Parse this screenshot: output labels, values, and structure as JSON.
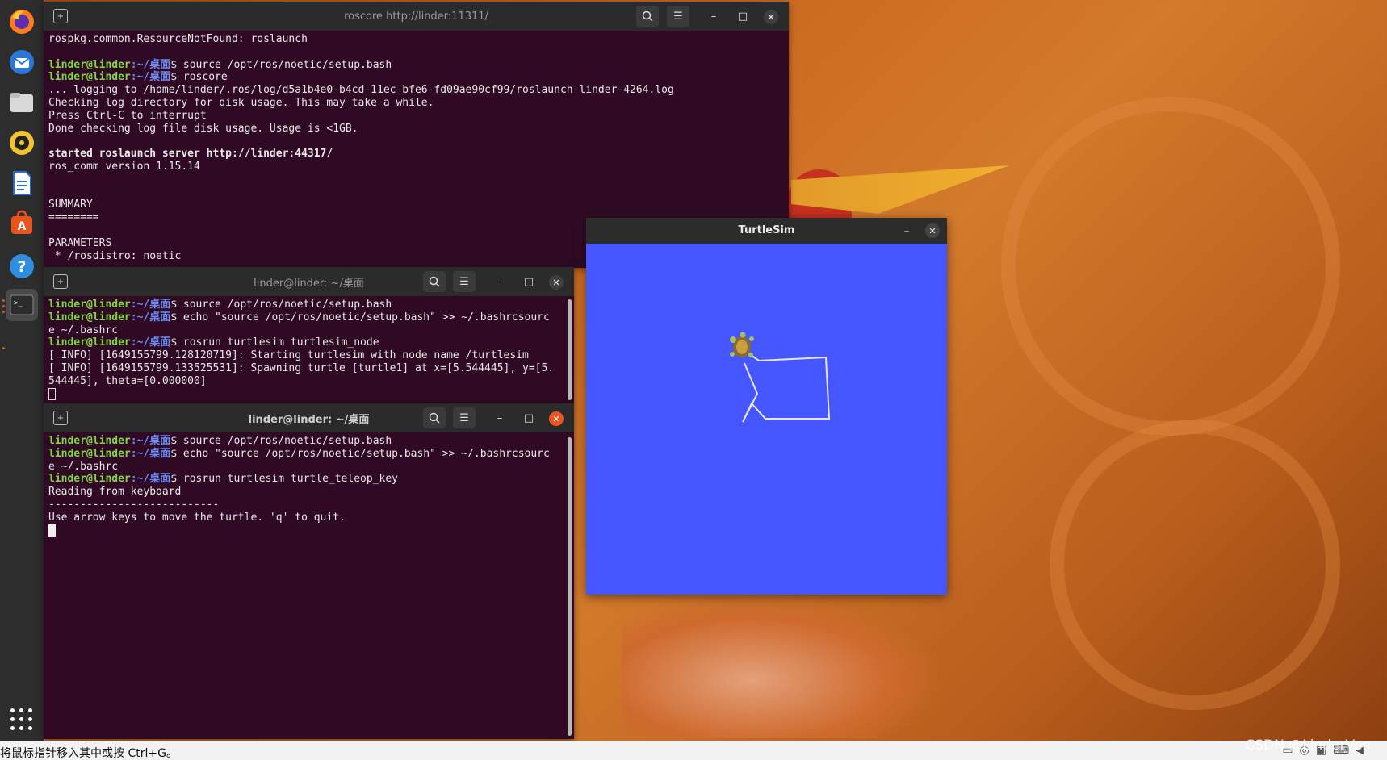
{
  "desktop": {
    "watermark": "CSDN @LinderVen"
  },
  "dock": {
    "items": [
      {
        "name": "firefox-icon"
      },
      {
        "name": "thunderbird-icon"
      },
      {
        "name": "files-icon"
      },
      {
        "name": "rhythmbox-icon"
      },
      {
        "name": "writer-icon"
      },
      {
        "name": "software-icon"
      },
      {
        "name": "help-icon"
      },
      {
        "name": "terminal-icon"
      }
    ]
  },
  "terminal1": {
    "title": "roscore http://linder:11311/",
    "lines": [
      {
        "text": "rospkg.common.ResourceNotFound: roslaunch"
      },
      {
        "text": ""
      },
      {
        "user": "linder@linder",
        "path": ":~/桌面",
        "text": "$ source /opt/ros/noetic/setup.bash"
      },
      {
        "user": "linder@linder",
        "path": ":~/桌面",
        "text": "$ roscore"
      },
      {
        "text": "... logging to /home/linder/.ros/log/d5a1b4e0-b4cd-11ec-bfe6-fd09ae90cf99/roslaunch-linder-4264.log"
      },
      {
        "text": "Checking log directory for disk usage. This may take a while."
      },
      {
        "text": "Press Ctrl-C to interrupt"
      },
      {
        "text": "Done checking log file disk usage. Usage is <1GB."
      },
      {
        "text": ""
      },
      {
        "text": "started roslaunch server http://linder:44317/",
        "bold": true
      },
      {
        "text": "ros_comm version 1.15.14"
      },
      {
        "text": ""
      },
      {
        "text": ""
      },
      {
        "text": "SUMMARY"
      },
      {
        "text": "========"
      },
      {
        "text": ""
      },
      {
        "text": "PARAMETERS"
      },
      {
        "text": " * /rosdistro: noetic"
      }
    ]
  },
  "terminal2": {
    "title": "linder@linder: ~/桌面",
    "lines": [
      {
        "user": "linder@linder",
        "path": ":~/桌面",
        "text": "$ source /opt/ros/noetic/setup.bash"
      },
      {
        "user": "linder@linder",
        "path": ":~/桌面",
        "text": "$ echo \"source /opt/ros/noetic/setup.bash\" >> ~/.bashrcsourc"
      },
      {
        "text": "e ~/.bashrc"
      },
      {
        "user": "linder@linder",
        "path": ":~/桌面",
        "text": "$ rosrun turtlesim turtlesim_node"
      },
      {
        "text": "[ INFO] [1649155799.128120719]: Starting turtlesim with node name /turtlesim"
      },
      {
        "text": "[ INFO] [1649155799.133525531]: Spawning turtle [turtle1] at x=[5.544445], y=[5."
      },
      {
        "text": "544445], theta=[0.000000]"
      }
    ]
  },
  "terminal3": {
    "title": "linder@linder: ~/桌面",
    "lines": [
      {
        "user": "linder@linder",
        "path": ":~/桌面",
        "text": "$ source /opt/ros/noetic/setup.bash"
      },
      {
        "user": "linder@linder",
        "path": ":~/桌面",
        "text": "$ echo \"source /opt/ros/noetic/setup.bash\" >> ~/.bashrcsourc"
      },
      {
        "text": "e ~/.bashrc"
      },
      {
        "user": "linder@linder",
        "path": ":~/桌面",
        "text": "$ rosrun turtlesim turtle_teleop_key"
      },
      {
        "text": "Reading from keyboard"
      },
      {
        "text": "---------------------------"
      },
      {
        "text": "Use arrow keys to move the turtle. 'q' to quit."
      }
    ]
  },
  "turtlesim": {
    "title": "TurtleSim",
    "background": "#4556ff",
    "path_color": "#e6e6ff"
  },
  "bottom_bar": {
    "hint": "将鼠标指针移入其中或按 Ctrl+G。"
  }
}
